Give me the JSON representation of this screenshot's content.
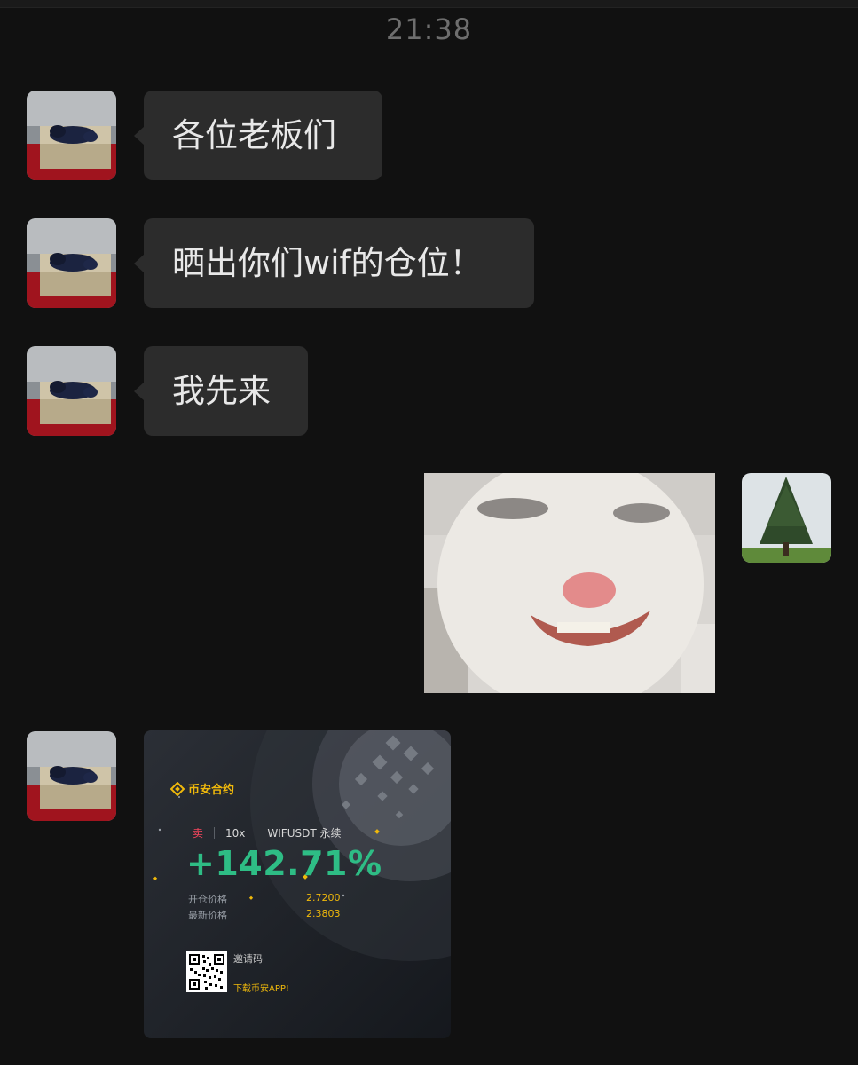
{
  "header": {
    "time": "21:38"
  },
  "messages": [
    {
      "from": "other",
      "type": "text",
      "text": "各位老板们"
    },
    {
      "from": "other",
      "type": "text",
      "text": "晒出你们wif的仓位！"
    },
    {
      "from": "other",
      "type": "text",
      "text": "我先来"
    },
    {
      "from": "self",
      "type": "sticker",
      "icon": "smiling-cat-sticker"
    },
    {
      "from": "other",
      "type": "image-card"
    }
  ],
  "card": {
    "brand": "币安合约",
    "side": "卖",
    "leverage": "10x",
    "symbol": "WIFUSDT 永续",
    "pnl_percent": "+142.71%",
    "entry_label": "开仓价格",
    "entry_value": "2.7200",
    "last_label": "最新价格",
    "last_value": "2.3803",
    "invite_label": "邀请码",
    "download_label": "下载币安APP!",
    "colors": {
      "gold": "#f0b90b",
      "green": "#2ebd85",
      "red": "#f6465d"
    }
  }
}
